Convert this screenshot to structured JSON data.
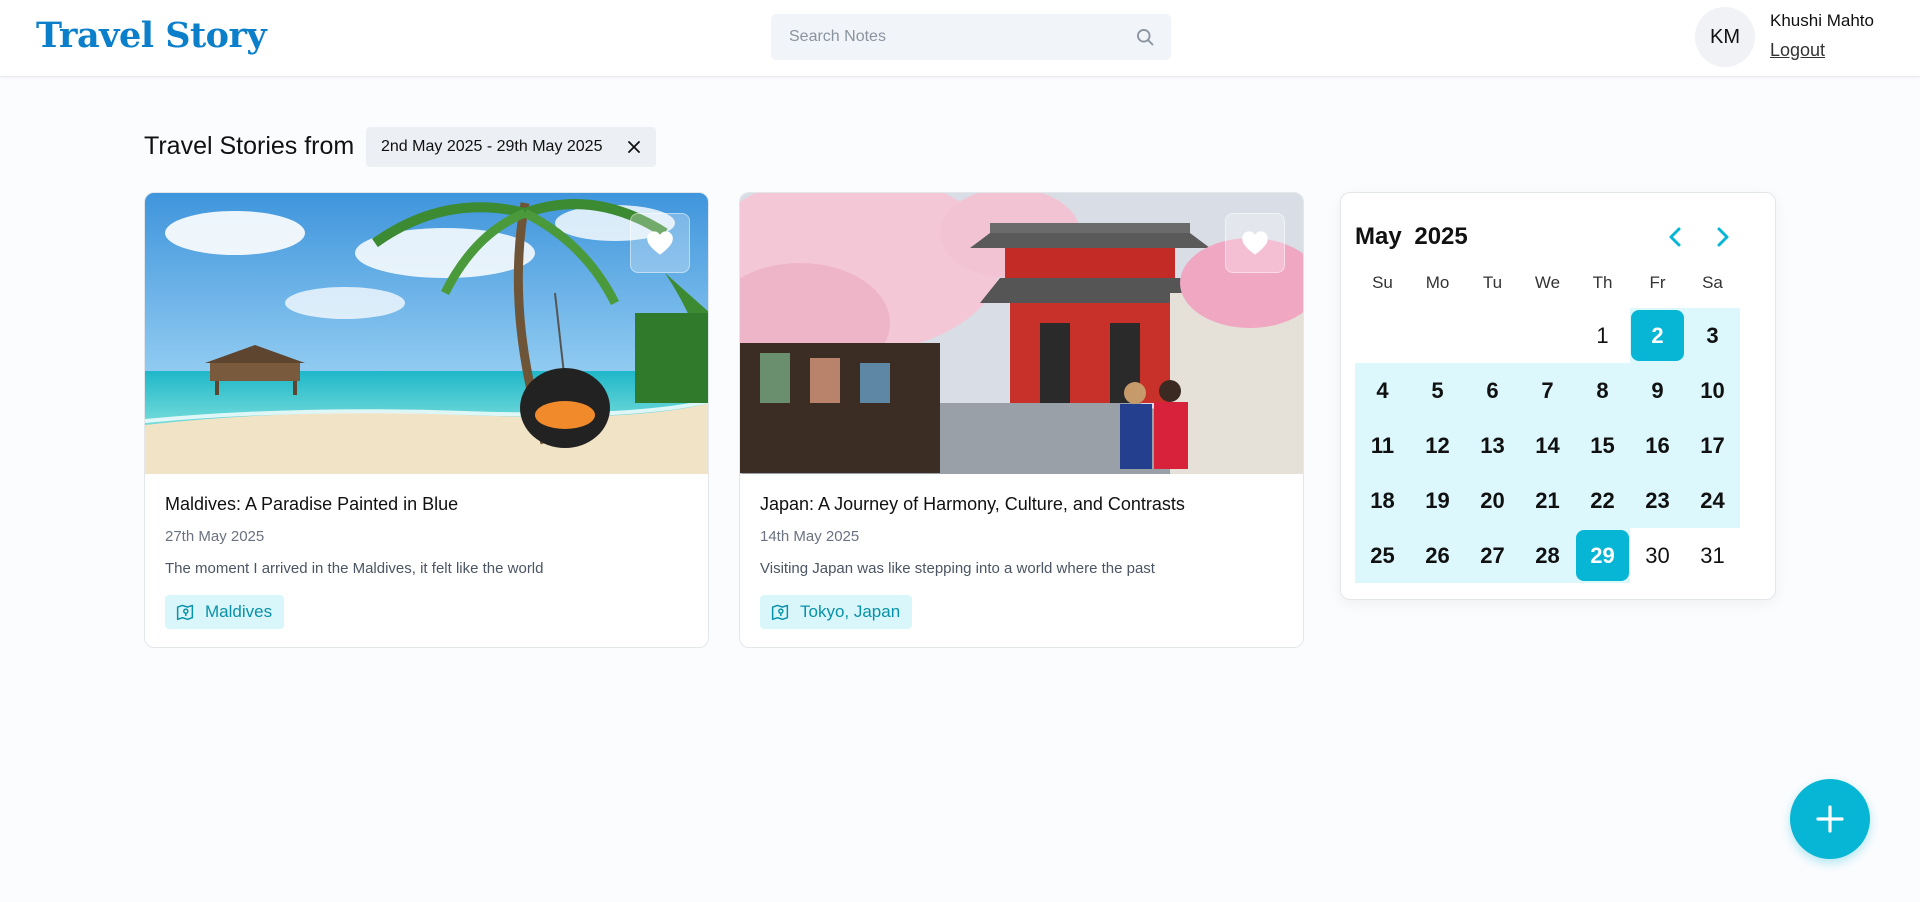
{
  "app": {
    "logo": "Travel Story",
    "brand_color": "#0b7fc9",
    "accent_color": "#06b6d4"
  },
  "search": {
    "placeholder": "Search Notes",
    "icon": "search-icon"
  },
  "user": {
    "initials": "KM",
    "name": "Khushi Mahto",
    "logout_label": "Logout"
  },
  "filter": {
    "title": "Travel Stories from",
    "range_label": "2nd May 2025 - 29th May 2025",
    "close_icon": "close-icon"
  },
  "stories": [
    {
      "title": "Maldives: A Paradise Painted in Blue",
      "date": "27th May 2025",
      "excerpt": "The moment I arrived in the Maldives, it felt like the world",
      "location": "Maldives",
      "favorite": true,
      "image": "tropical beach with palm tree, swing and overwater villas"
    },
    {
      "title": "Japan: A Journey of Harmony, Culture, and Contrasts",
      "date": "14th May 2025",
      "excerpt": "Visiting Japan was like stepping into a world where the past",
      "location": "Tokyo, Japan",
      "favorite": true,
      "image": "red temple gate with cherry blossoms and people in kimonos"
    }
  ],
  "calendar": {
    "month": "May",
    "year": "2025",
    "weekdays": [
      "Su",
      "Mo",
      "Tu",
      "We",
      "Th",
      "Fr",
      "Sa"
    ],
    "first_weekday_index": 4,
    "days_in_month": 31,
    "range_start": 2,
    "range_end": 29
  },
  "fab": {
    "icon": "plus-icon"
  }
}
